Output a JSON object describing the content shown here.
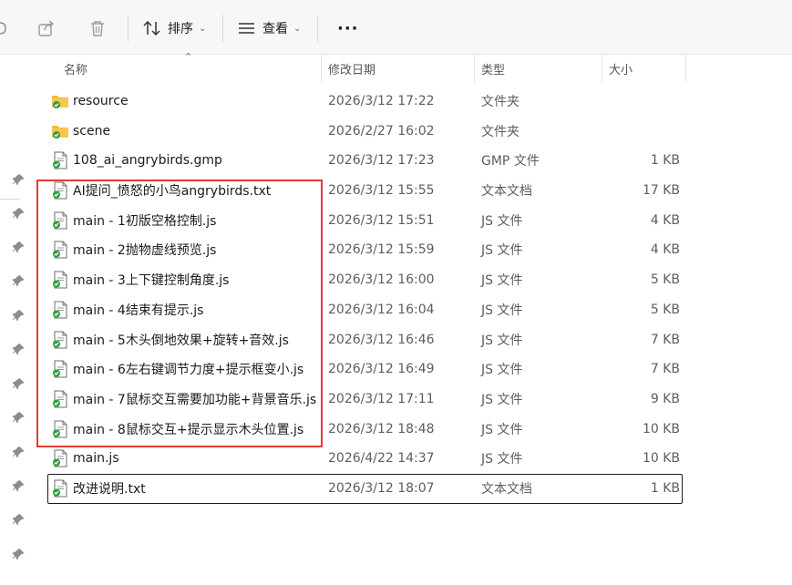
{
  "toolbar": {
    "sort_label": "排序",
    "view_label": "查看",
    "more_label": "···",
    "icons": [
      "share-icon",
      "delete-icon",
      "sort-icon",
      "view-icon",
      "more-icon"
    ]
  },
  "columns": {
    "name": "名称",
    "date": "修改日期",
    "type": "类型",
    "size": "大小"
  },
  "files": [
    {
      "name": "resource",
      "date": "2026/3/12 17:22",
      "type": "文件夹",
      "size": "",
      "icon": "folder-icon"
    },
    {
      "name": "scene",
      "date": "2026/2/27 16:02",
      "type": "文件夹",
      "size": "",
      "icon": "folder-icon"
    },
    {
      "name": "108_ai_angrybirds.gmp",
      "date": "2026/3/12 17:23",
      "type": "GMP 文件",
      "size": "1 KB",
      "icon": "file-icon"
    },
    {
      "name": "AI提问_愤怒的小鸟angrybirds.txt",
      "date": "2026/3/12 15:55",
      "type": "文本文档",
      "size": "17 KB",
      "icon": "file-icon"
    },
    {
      "name": "main - 1初版空格控制.js",
      "date": "2026/3/12 15:51",
      "type": "JS 文件",
      "size": "4 KB",
      "icon": "file-icon"
    },
    {
      "name": "main - 2抛物虚线预览.js",
      "date": "2026/3/12 15:59",
      "type": "JS 文件",
      "size": "4 KB",
      "icon": "file-icon"
    },
    {
      "name": "main - 3上下键控制角度.js",
      "date": "2026/3/12 16:00",
      "type": "JS 文件",
      "size": "5 KB",
      "icon": "file-icon"
    },
    {
      "name": "main - 4结束有提示.js",
      "date": "2026/3/12 16:04",
      "type": "JS 文件",
      "size": "5 KB",
      "icon": "file-icon"
    },
    {
      "name": "main - 5木头倒地效果+旋转+音效.js",
      "date": "2026/3/12 16:46",
      "type": "JS 文件",
      "size": "7 KB",
      "icon": "file-icon"
    },
    {
      "name": "main - 6左右键调节力度+提示框变小.js",
      "date": "2026/3/12 16:49",
      "type": "JS 文件",
      "size": "7 KB",
      "icon": "file-icon"
    },
    {
      "name": "main - 7鼠标交互需要加功能+背景音乐.js",
      "date": "2026/3/12 17:11",
      "type": "JS 文件",
      "size": "9 KB",
      "icon": "file-icon"
    },
    {
      "name": "main - 8鼠标交互+提示显示木头位置.js",
      "date": "2026/3/12 18:48",
      "type": "JS 文件",
      "size": "10 KB",
      "icon": "file-icon"
    },
    {
      "name": "main.js",
      "date": "2026/4/22 14:37",
      "type": "JS 文件",
      "size": "10 KB",
      "icon": "file-icon"
    },
    {
      "name": "改进说明.txt",
      "date": "2026/3/12 18:07",
      "type": "文本文档",
      "size": "1 KB",
      "icon": "file-icon"
    }
  ],
  "colors": {
    "annotation_red": "#e53935",
    "folder_yellow": "#f4b93d",
    "sync_green": "#2e9e3e"
  }
}
